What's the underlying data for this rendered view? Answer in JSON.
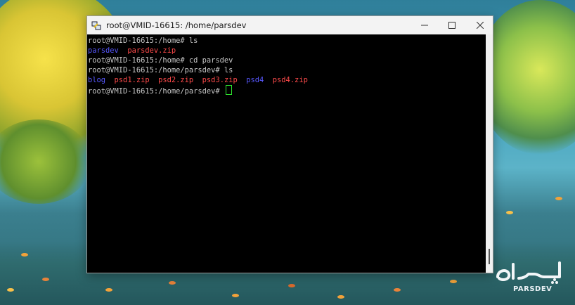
{
  "window": {
    "title": "root@VMID-16615: /home/parsdev",
    "icon": "putty-icon",
    "controls": [
      "minimize-icon",
      "maximize-icon",
      "close-icon"
    ]
  },
  "terminal": {
    "lines": [
      {
        "segments": [
          {
            "text": "root@VMID-16615:/home# ls",
            "type": "plain"
          }
        ]
      },
      {
        "segments": [
          {
            "text": "parsdev",
            "type": "dir"
          },
          {
            "text": "  ",
            "type": "plain"
          },
          {
            "text": "parsdev.zip",
            "type": "zip"
          }
        ]
      },
      {
        "segments": [
          {
            "text": "root@VMID-16615:/home# cd parsdev",
            "type": "plain"
          }
        ]
      },
      {
        "segments": [
          {
            "text": "root@VMID-16615:/home/parsdev# ls",
            "type": "plain"
          }
        ]
      },
      {
        "segments": [
          {
            "text": "blog",
            "type": "dir"
          },
          {
            "text": "  ",
            "type": "plain"
          },
          {
            "text": "psd1.zip",
            "type": "zip"
          },
          {
            "text": "  ",
            "type": "plain"
          },
          {
            "text": "psd2.zip",
            "type": "zip"
          },
          {
            "text": "  ",
            "type": "plain"
          },
          {
            "text": "psd3.zip",
            "type": "zip"
          },
          {
            "text": "  ",
            "type": "plain"
          },
          {
            "text": "psd4",
            "type": "dir"
          },
          {
            "text": "  ",
            "type": "plain"
          },
          {
            "text": "psd4.zip",
            "type": "zip"
          }
        ]
      },
      {
        "segments": [
          {
            "text": "root@VMID-16615:/home/parsdev# ",
            "type": "plain"
          }
        ],
        "cursor": true
      }
    ],
    "colors": {
      "background": "#000000",
      "text": "#c8c8c8",
      "dir": "#5858ff",
      "zip": "#ff4b4b",
      "cursor": "#2ee62e"
    }
  },
  "watermark": {
    "logo_text_fa": "پارس‌دو",
    "logo_text_en": "PARSDEV"
  }
}
